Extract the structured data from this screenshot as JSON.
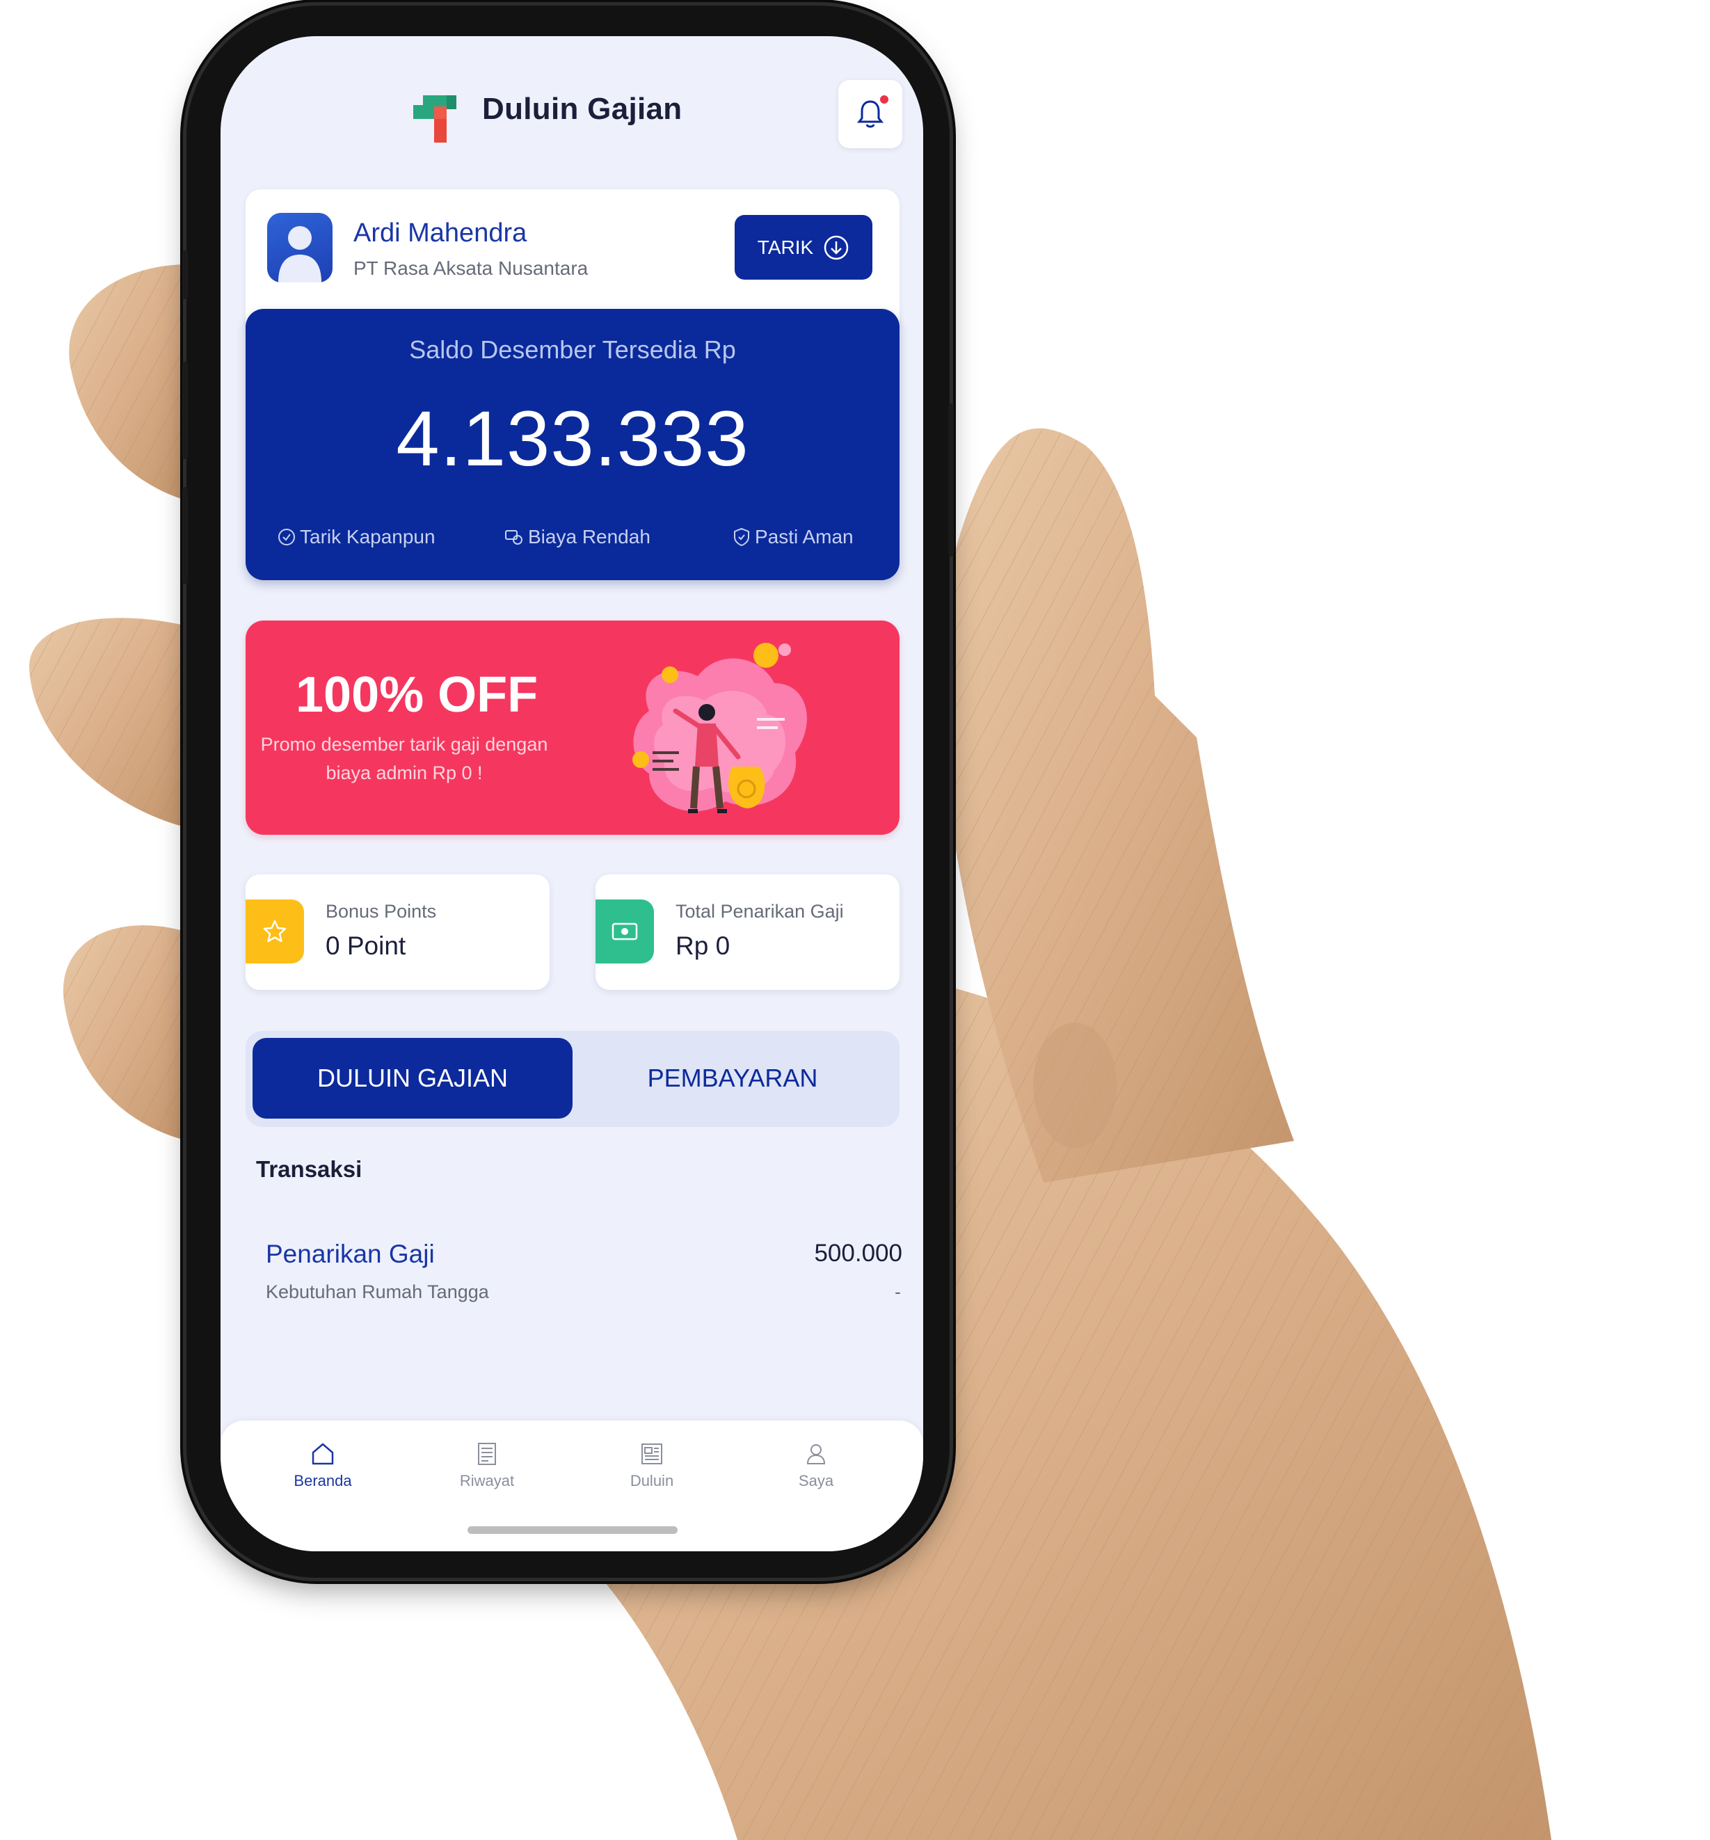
{
  "app": {
    "title": "Duluin Gajian"
  },
  "profile": {
    "name": "Ardi Mahendra",
    "company": "PT Rasa Aksata Nusantara",
    "withdraw_label": "TARIK"
  },
  "balance": {
    "label": "Saldo Desember Tersedia Rp",
    "amount": "4.133.333",
    "features": [
      "Tarik Kapanpun",
      "Biaya Rendah",
      "Pasti Aman"
    ]
  },
  "promo": {
    "title": "100% OFF",
    "description_line1": "Promo desember tarik gaji dengan",
    "description_line2": "biaya admin Rp 0 !"
  },
  "stats": [
    {
      "label": "Bonus Points",
      "value": "0 Point",
      "icon": "star-icon",
      "color": "#fdbe18"
    },
    {
      "label": "Total Penarikan Gaji",
      "value": "Rp 0",
      "icon": "cash-icon",
      "color": "#2fbf8f"
    }
  ],
  "tabs": [
    {
      "label": "DULUIN GAJIAN",
      "active": true
    },
    {
      "label": "PEMBAYARAN",
      "active": false
    }
  ],
  "transactions": {
    "section_title": "Transaksi",
    "items": [
      {
        "title": "Penarikan Gaji",
        "category": "Kebutuhan Rumah Tangga",
        "amount": "500.000",
        "note": "-"
      }
    ]
  },
  "nav": [
    {
      "label": "Beranda",
      "icon": "home-icon",
      "active": true
    },
    {
      "label": "Riwayat",
      "icon": "receipt-icon",
      "active": false
    },
    {
      "label": "Duluin",
      "icon": "newspaper-icon",
      "active": false
    },
    {
      "label": "Saya",
      "icon": "user-icon",
      "active": false
    }
  ],
  "colors": {
    "primary": "#0c2a9c",
    "promo": "#f5375f",
    "background": "#eef1fb",
    "notification_dot": "#e8334a"
  }
}
